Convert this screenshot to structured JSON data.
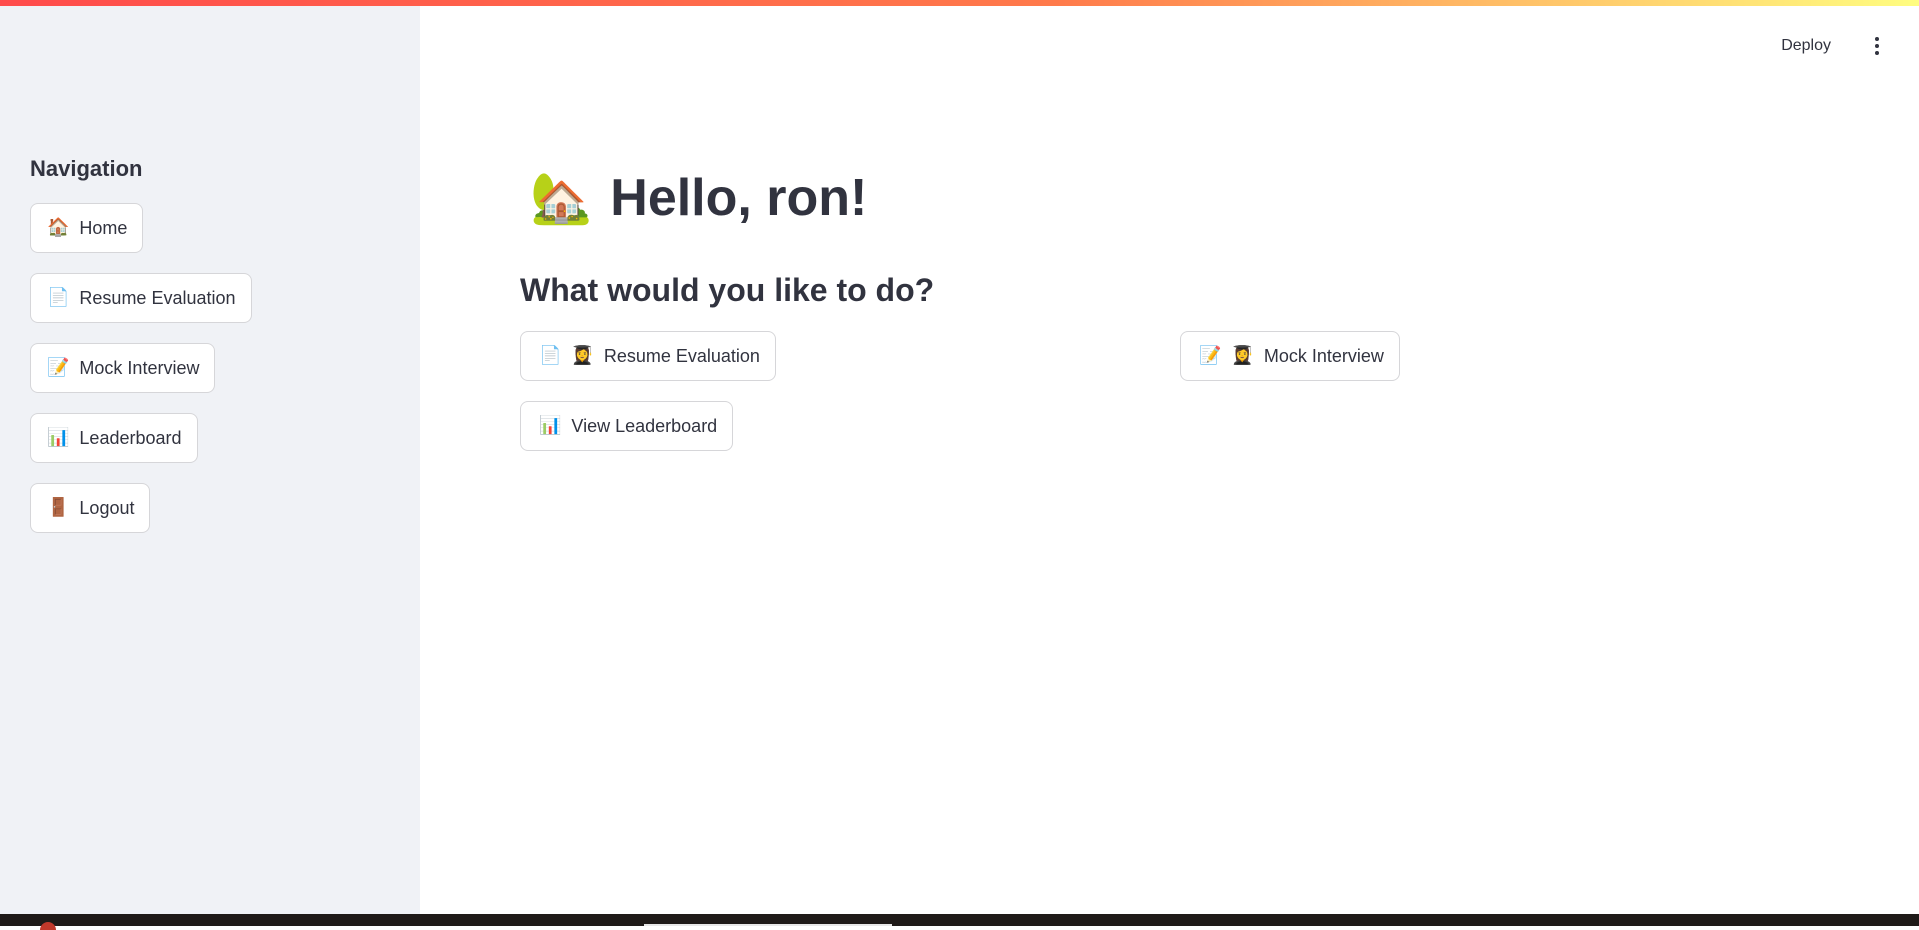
{
  "header": {
    "deploy_label": "Deploy",
    "menu_icon": "kebab-vertical-icon"
  },
  "sidebar": {
    "title": "Navigation",
    "items": [
      {
        "icon": "🏠",
        "icon_name": "house-icon",
        "label": "Home"
      },
      {
        "icon": "📄",
        "icon_name": "page-facing-up-icon",
        "label": "Resume Evaluation"
      },
      {
        "icon": "📝",
        "icon_name": "memo-icon",
        "label": "Mock Interview"
      },
      {
        "icon": "📊",
        "icon_name": "bar-chart-icon",
        "label": "Leaderboard"
      },
      {
        "icon": "🚪",
        "icon_name": "door-icon",
        "label": "Logout"
      }
    ]
  },
  "main": {
    "greeting_icon": "🏡",
    "greeting": "Hello, ron!",
    "subheading": "What would you like to do?",
    "actions": [
      {
        "icons": [
          "📄",
          "👩‍🎓"
        ],
        "icon_names": [
          "page-facing-up-icon",
          "graduate-icon"
        ],
        "label": "Resume Evaluation"
      },
      {
        "icons": [
          "📝",
          "👩‍🎓"
        ],
        "icon_names": [
          "memo-icon",
          "graduate-icon"
        ],
        "label": "Mock Interview"
      },
      {
        "icons": [
          "📊"
        ],
        "icon_names": [
          "bar-chart-icon"
        ],
        "label": "View Leaderboard"
      }
    ]
  },
  "colors": {
    "sidebar_bg": "#f0f2f6",
    "text": "#31333f",
    "accent": "#ff4b4b",
    "border": "rgba(49, 51, 63, 0.2)"
  }
}
